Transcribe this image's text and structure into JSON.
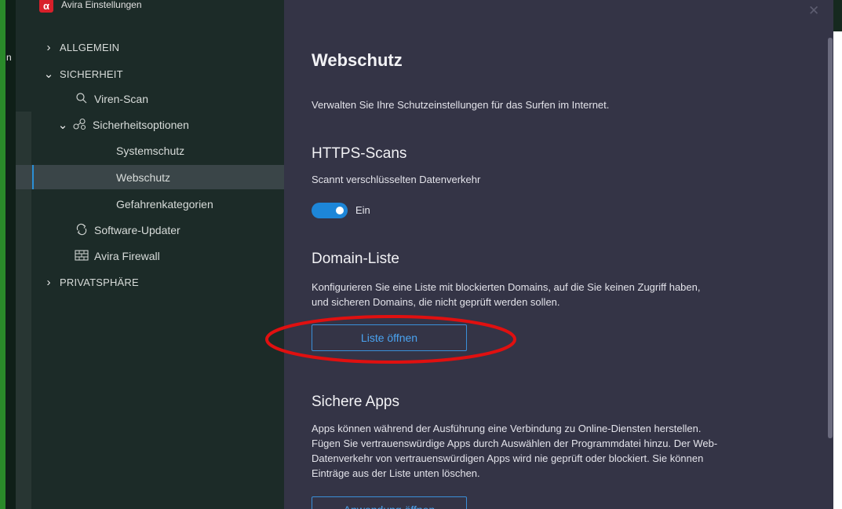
{
  "window": {
    "title": "Avira Einstellungen",
    "logo_glyph": "α",
    "close_glyph": "✕",
    "left_edge_char": "n"
  },
  "colors": {
    "sidebar_bg": "#1c2b28",
    "main_bg": "#343446",
    "accent": "#1d86d8",
    "logo": "#d8202a",
    "annotation": "#e01010"
  },
  "sidebar": {
    "items": [
      {
        "label": "ALLGEMEIN",
        "expanded": false
      },
      {
        "label": "SICHERHEIT",
        "expanded": true
      },
      {
        "label": "Viren-Scan",
        "icon": "magnifier-icon"
      },
      {
        "label": "Sicherheitsoptionen",
        "icon": "molecule-icon",
        "expanded": true
      },
      {
        "label": "Systemschutz"
      },
      {
        "label": "Webschutz",
        "selected": true
      },
      {
        "label": "Gefahrenkategorien"
      },
      {
        "label": "Software-Updater",
        "icon": "refresh-icon"
      },
      {
        "label": "Avira Firewall",
        "icon": "firewall-icon"
      },
      {
        "label": "PRIVATSPHÄRE",
        "expanded": false
      }
    ]
  },
  "main": {
    "title": "Webschutz",
    "description": "Verwalten Sie Ihre Schutzeinstellungen für das Surfen im Internet.",
    "https": {
      "heading": "HTTPS-Scans",
      "description": "Scannt verschlüsselten Datenverkehr",
      "toggle_on": true,
      "toggle_label": "Ein"
    },
    "domain": {
      "heading": "Domain-Liste",
      "description_line1": "Konfigurieren Sie eine Liste mit blockierten Domains, auf die Sie keinen Zugriff haben,",
      "description_line2": "und sicheren Domains, die nicht geprüft werden sollen.",
      "button": "Liste öffnen"
    },
    "apps": {
      "heading": "Sichere Apps",
      "description_line1": "Apps können während der Ausführung eine Verbindung zu Online-Diensten herstellen.",
      "description_line2": "Fügen Sie vertrauenswürdige Apps durch Auswählen der Programmdatei hinzu. Der Web-",
      "description_line3": "Datenverkehr von vertrauenswürdigen Apps wird nie geprüft oder blockiert. Sie können",
      "description_line4": "Einträge aus der Liste unten löschen.",
      "button": "Anwendung öffnen"
    }
  }
}
